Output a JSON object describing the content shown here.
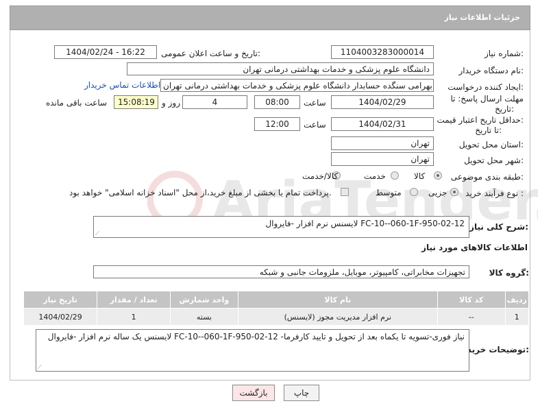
{
  "header": {
    "title": "جزئیات اطلاعات نیاز"
  },
  "fields": {
    "need_number_label": "شماره نیاز:",
    "need_number": "1104003283000014",
    "announce_label": "تاریخ و ساعت اعلان عمومی:",
    "announce_value": "1404/02/24 - 16:22",
    "buyer_org_label": "نام دستگاه خریدار:",
    "buyer_org": "دانشگاه علوم پزشکی و خدمات بهداشتی درمانی تهران",
    "creator_label": "ایجاد کننده درخواست:",
    "creator": "فرزام بهرامی سنگده حسابدار دانشگاه علوم پزشکی و خدمات بهداشتی درمانی تهران",
    "contact_link": "اطلاعات تماس خریدار",
    "deadline_label_1": "مهلت ارسال پاسخ: تا",
    "deadline_label_2": "تاریخ:",
    "deadline_date": "1404/02/29",
    "time_label": "ساعت",
    "deadline_time": "08:00",
    "days_value": "4",
    "days_label": "روز و",
    "remaining_time": "15:08:19",
    "remaining_label": "ساعت باقی مانده",
    "price_label_1": "حداقل تاریخ اعتبار قیمت:",
    "price_label_2": "تا تاریخ:",
    "price_date": "1404/02/31",
    "price_time": "12:00",
    "province_label": "استان محل تحویل:",
    "province": "تهران",
    "city_label": "شهر محل تحویل:",
    "city": "تهران",
    "category_label": "طبقه بندی موضوعی:",
    "category_options": [
      "کالا",
      "خدمت",
      "کالا/خدمت"
    ],
    "process_label": "نوع فرآیند خرید :",
    "process_options": [
      "جزیی",
      "متوسط"
    ],
    "payment_note": "پرداخت تمام یا بخشی از مبلغ خرید،از محل \"اسناد خزانه اسلامی\" خواهد بود."
  },
  "summary": {
    "label": "شرح کلی نیاز:",
    "value": "لایسنس نرم افزار -فایروال FC-10--060-1F-950-02-12"
  },
  "goods": {
    "section_title": "اطلاعات کالاهای مورد نیاز",
    "group_label": "گروه کالا:",
    "group_value": "تجهیزات مخابراتی، کامپیوتر، موبایل، ملزومات جانبی و شبکه",
    "columns": [
      "ردیف",
      "کد کالا",
      "نام کالا",
      "واحد شمارش",
      "تعداد / مقدار",
      "تاریخ نیاز"
    ],
    "rows": [
      [
        "1",
        "--",
        "نرم افزار مدیریت مجوز (لایسنس)",
        "بسته",
        "1",
        "1404/02/29"
      ]
    ]
  },
  "buyer_notes": {
    "label": "توضیحات خریدار:",
    "value": "لایسنس یک ساله نرم افزار -فایروال FC-10--060-1F-950-02-12 -نیاز فوری-تسویه تا یکماه بعد از تحویل و تایید کارفرما"
  },
  "buttons": {
    "print": "چاپ",
    "back": "بازگشت"
  },
  "colors": {
    "header_bg": "#b0b0b0",
    "link": "#1a4fbf",
    "highlight": "#ffffcc",
    "back_btn": "#fde6e6"
  }
}
